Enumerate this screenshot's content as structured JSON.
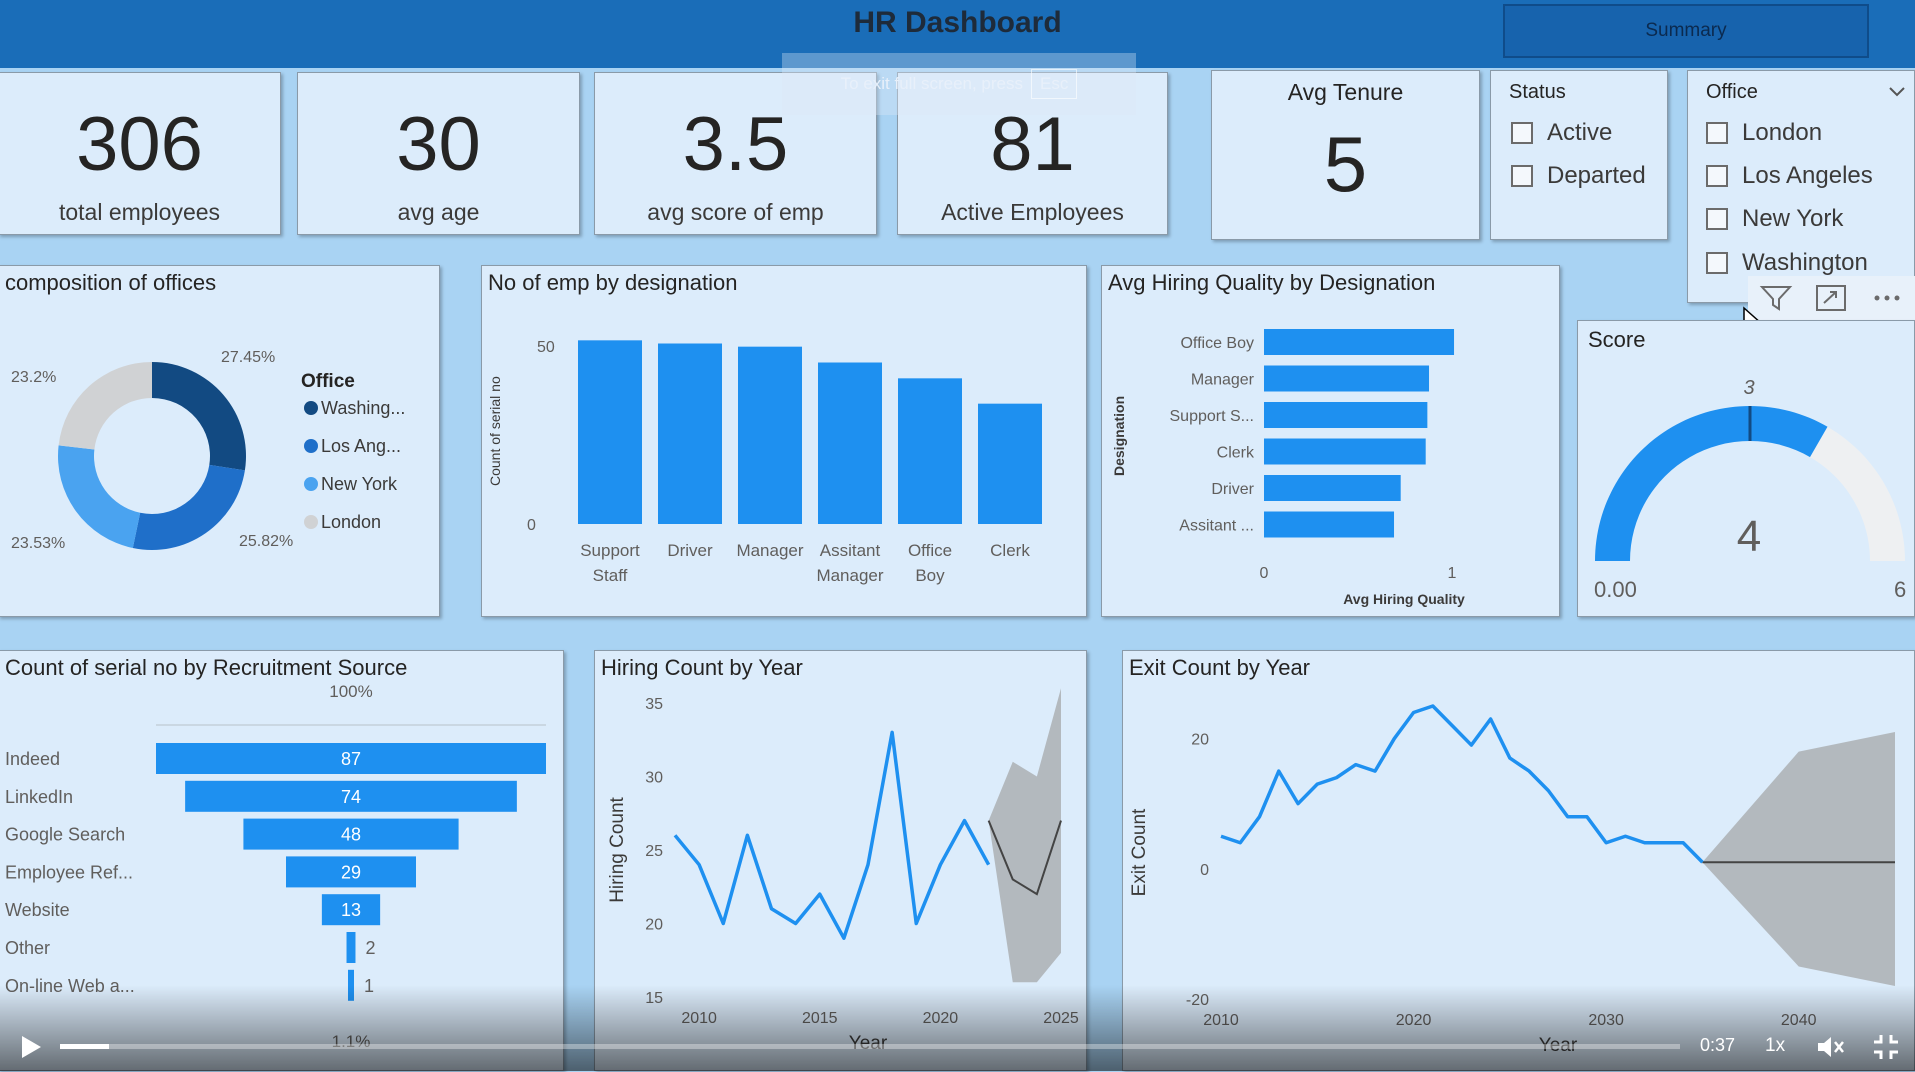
{
  "header": {
    "title": "HR Dashboard",
    "summary_button": "Summary"
  },
  "fullscreen_hint": {
    "text": "To exit full screen, press",
    "key": "Esc"
  },
  "kpis": [
    {
      "value": "306",
      "label": "total employees"
    },
    {
      "value": "30",
      "label": "avg age"
    },
    {
      "value": "3.5",
      "label": "avg score  of emp"
    },
    {
      "value": "81",
      "label": "Active Employees"
    }
  ],
  "avg_tenure": {
    "title": "Avg Tenure",
    "value": "5"
  },
  "status_slicer": {
    "title": "Status",
    "options": [
      "Active",
      "Departed"
    ]
  },
  "office_slicer": {
    "title": "Office",
    "options": [
      "London",
      "Los Angeles",
      "New York",
      "Washington"
    ]
  },
  "colors": {
    "dark_blue": "#124a82",
    "mid_blue": "#1f6fc9",
    "bright_blue": "#1e90f0",
    "light_blue": "#5aaaf2",
    "grey": "#d0d2d4",
    "card_bg": "#dcecfb",
    "header_bg": "#1a6db8"
  },
  "score_gauge": {
    "title": "Score",
    "value": 4,
    "target": 3,
    "min_label": "0.00",
    "max_label": "6",
    "min": 0,
    "max": 6,
    "target_label": "3",
    "value_label": "4"
  },
  "chart_data": [
    {
      "type": "pie",
      "title": "composition of offices",
      "legend_title": "Office",
      "labels": [
        "Washing...",
        "Los Ang...",
        "New York",
        "London"
      ],
      "values": [
        27.45,
        25.82,
        23.53,
        23.2
      ],
      "value_labels": [
        "27.45%",
        "25.82%",
        "23.53%",
        "23.2%"
      ],
      "colors": [
        "#124a82",
        "#1f6fc9",
        "#4aa3f0",
        "#d0d2d4"
      ]
    },
    {
      "type": "bar",
      "title": "No of emp by designation",
      "categories": [
        "Support Staff",
        "Driver",
        "Manager",
        "Assitant Manager",
        "Office Boy",
        "Clerk"
      ],
      "values": [
        58,
        57,
        56,
        51,
        46,
        38
      ],
      "ylabel": "Count of serial no",
      "xlabel": "",
      "yticks": [
        "0",
        "50"
      ],
      "ylim": [
        0,
        60
      ]
    },
    {
      "type": "bar",
      "orientation": "horizontal",
      "title": "Avg Hiring Quality by Designation",
      "categories": [
        "Office Boy",
        "Manager",
        "Support S...",
        "Clerk",
        "Driver",
        "Assitant ..."
      ],
      "values": [
        1.14,
        0.99,
        0.98,
        0.97,
        0.82,
        0.78
      ],
      "ylabel": "Designation",
      "xlabel": "Avg Hiring Quality",
      "xticks": [
        "0",
        "1"
      ],
      "xlim": [
        0,
        1.5
      ]
    },
    {
      "type": "bar",
      "orientation": "funnel",
      "title": "Count of serial no by Recruitment Source",
      "categories": [
        "Indeed",
        "LinkedIn",
        "Google Search",
        "Employee Ref...",
        "Website",
        "Other",
        "On-line Web a..."
      ],
      "values": [
        87,
        74,
        48,
        29,
        13,
        2,
        1
      ],
      "value_labels": [
        "87",
        "74",
        "48",
        "29",
        "13",
        "2",
        "1"
      ],
      "top_label": "100%",
      "bottom_label": "1.1%"
    },
    {
      "type": "line",
      "title": "Hiring Count by Year",
      "x": [
        2009,
        2010,
        2011,
        2012,
        2013,
        2014,
        2015,
        2016,
        2017,
        2018,
        2019,
        2020,
        2021,
        2022
      ],
      "values": [
        26,
        24,
        20,
        26,
        21,
        20,
        22,
        19,
        24,
        33,
        20,
        24,
        27,
        24
      ],
      "forecast": {
        "x": [
          2022,
          2023,
          2024,
          2025
        ],
        "values": [
          27,
          23,
          22,
          27
        ],
        "upper": [
          27,
          31,
          30,
          36
        ],
        "lower": [
          27,
          16,
          16,
          18
        ]
      },
      "xlabel": "Year",
      "ylabel": "Hiring Count",
      "xticks": [
        "2010",
        "2015",
        "2020",
        "2025"
      ],
      "yticks": [
        "15",
        "20",
        "25",
        "30",
        "35"
      ],
      "xlim": [
        2009,
        2025
      ],
      "ylim": [
        15,
        35
      ]
    },
    {
      "type": "line",
      "title": "Exit Count by Year",
      "x": [
        2010,
        2011,
        2012,
        2013,
        2014,
        2015,
        2016,
        2017,
        2018,
        2019,
        2020,
        2021,
        2022,
        2023,
        2024,
        2025,
        2026,
        2027,
        2028,
        2029,
        2030,
        2031,
        2032,
        2033,
        2034,
        2035
      ],
      "values": [
        5,
        4,
        8,
        15,
        10,
        13,
        14,
        16,
        15,
        20,
        24,
        25,
        22,
        19,
        23,
        17,
        15,
        12,
        8,
        8,
        4,
        5,
        4,
        4,
        4,
        1
      ],
      "forecast": {
        "x": [
          2035,
          2040,
          2045
        ],
        "values": [
          1,
          1,
          1
        ],
        "upper": [
          1,
          18,
          21
        ],
        "lower": [
          1,
          -15,
          -18
        ]
      },
      "xlabel": "Year",
      "ylabel": "Exit Count",
      "xticks": [
        "2010",
        "2020",
        "2030",
        "2040"
      ],
      "yticks": [
        "-20",
        "0",
        "20"
      ],
      "xlim": [
        2010,
        2045
      ],
      "ylim": [
        -20,
        25
      ]
    }
  ],
  "player": {
    "time": "0:37",
    "speed": "1x",
    "progress": 0.03
  }
}
